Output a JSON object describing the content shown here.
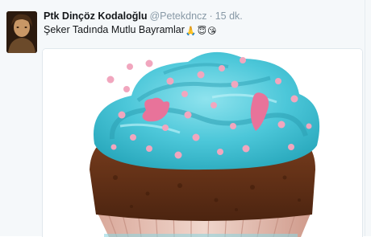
{
  "tweet": {
    "display_name": "Ptk Dinçöz Kodaloğlu",
    "handle": "@Petekdncz",
    "separator": "·",
    "timestamp": "15 dk.",
    "text": "Şeker Tadında Mutlu Bayramlar",
    "emojis": [
      "🙏",
      "😇",
      "😘"
    ],
    "avatar_icon": "profile-photo",
    "media_icon": "cupcake-photo"
  }
}
